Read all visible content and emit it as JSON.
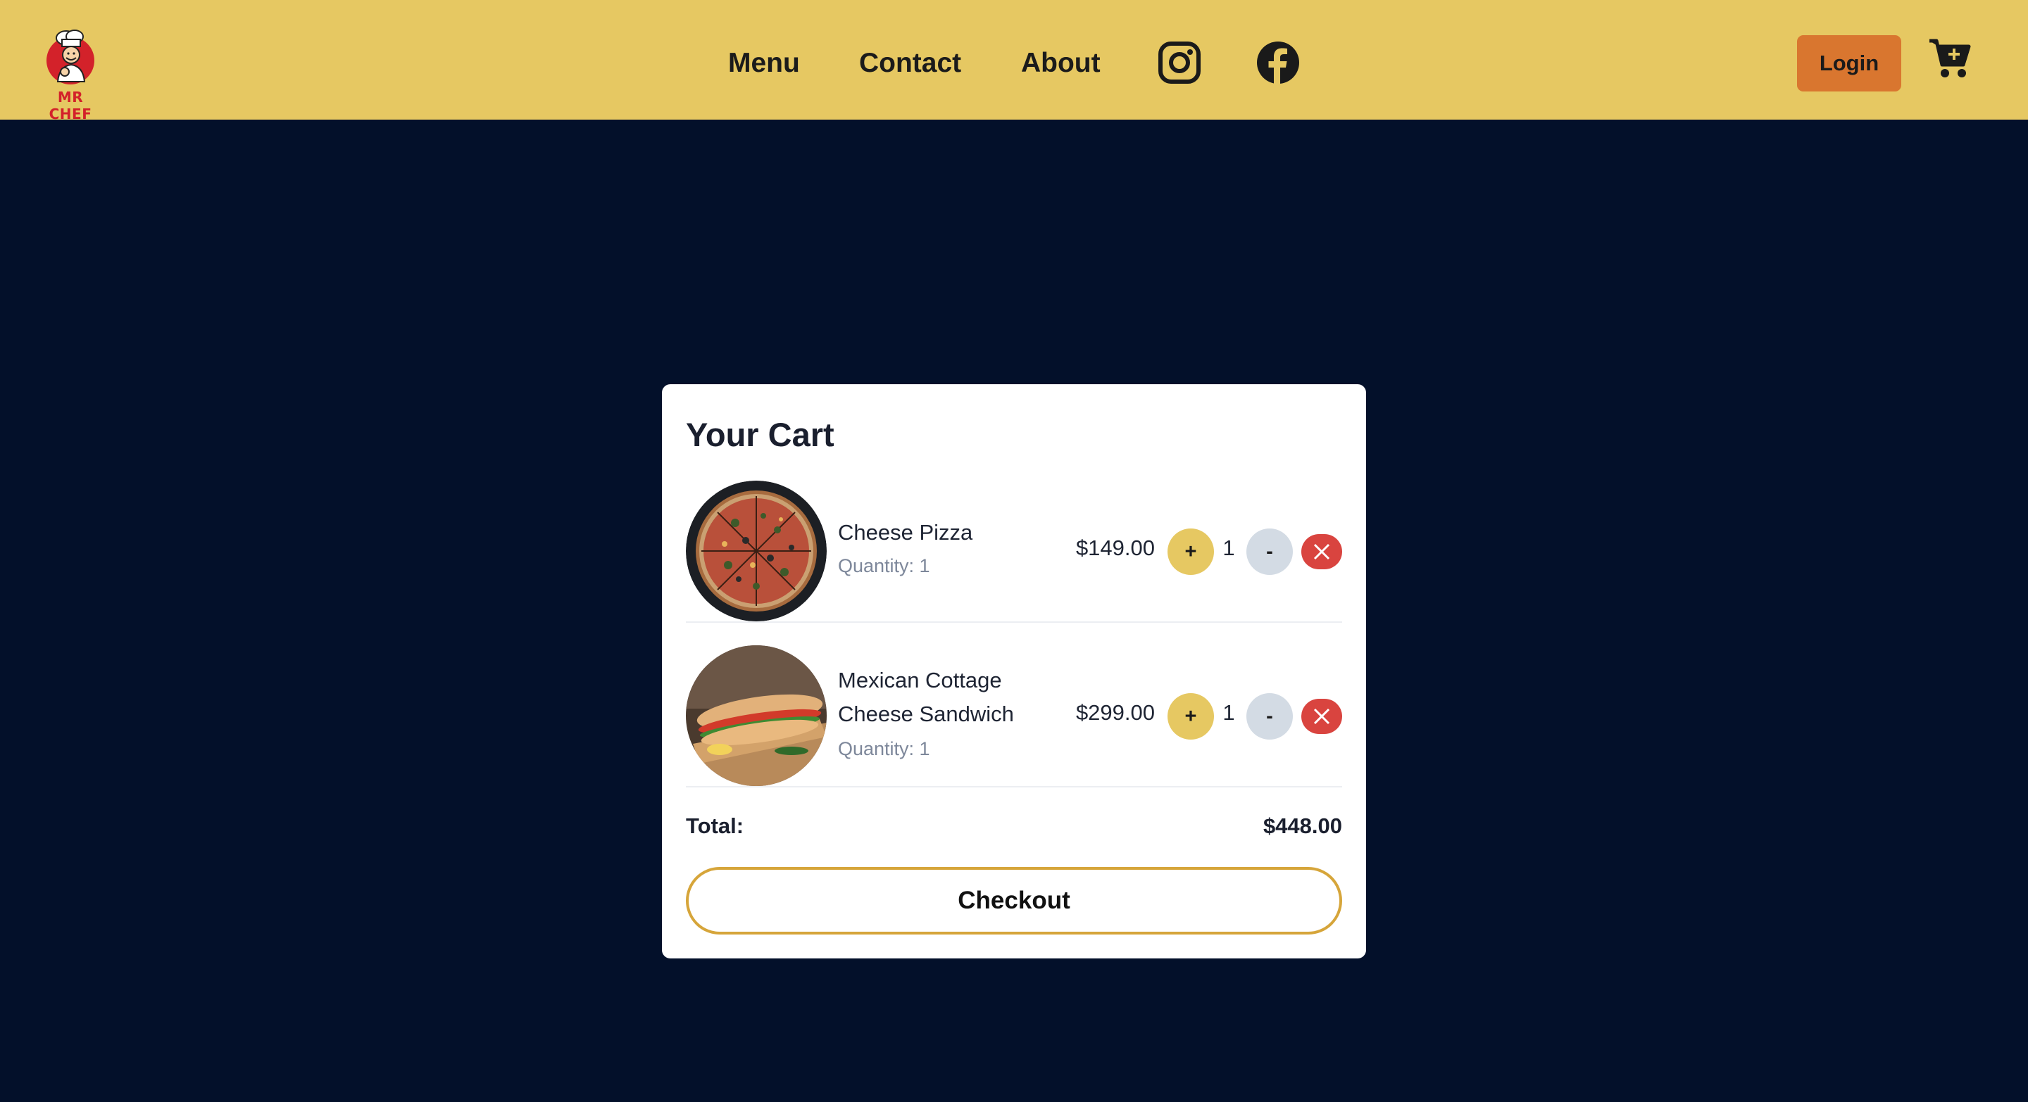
{
  "brand": {
    "logo_text": "MR CHEF",
    "nav_color": "#e6c862",
    "background": "#03102a"
  },
  "nav": {
    "links": [
      {
        "label": "Menu"
      },
      {
        "label": "Contact"
      },
      {
        "label": "About"
      }
    ],
    "social": [
      {
        "icon": "instagram-icon"
      },
      {
        "icon": "facebook-icon"
      }
    ],
    "login_label": "Login",
    "cart_icon": "cart-plus-icon"
  },
  "cart": {
    "title": "Your Cart",
    "items": [
      {
        "name": "Cheese Pizza",
        "quantity_text": "Quantity: 1",
        "price": "$149.00",
        "qty": "1",
        "plus_label": "+",
        "minus_label": "-",
        "image": "pizza-image"
      },
      {
        "name": "Mexican Cottage Cheese Sandwich",
        "quantity_text": "Quantity: 1",
        "price": "$299.00",
        "qty": "1",
        "plus_label": "+",
        "minus_label": "-",
        "image": "sandwich-image"
      }
    ],
    "total_label": "Total:",
    "total_value": "$448.00",
    "checkout_label": "Checkout"
  }
}
